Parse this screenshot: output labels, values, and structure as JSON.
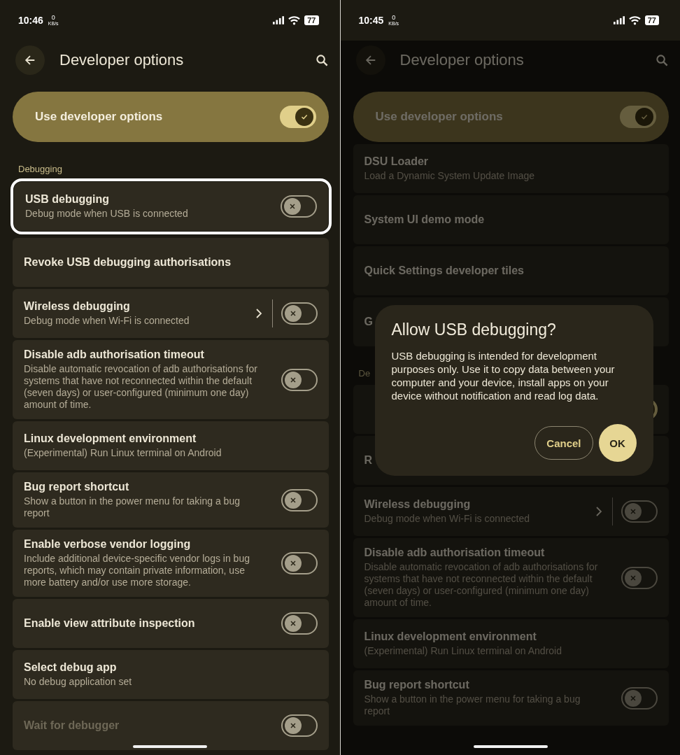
{
  "screens": [
    {
      "time": "10:46",
      "speed_value": "0",
      "speed_unit": "KB/s",
      "battery": "77",
      "title": "Developer options",
      "dimmed": false,
      "master": {
        "label": "Use developer options",
        "checked": true
      },
      "items": [
        {
          "kind": "section",
          "title": "Debugging"
        },
        {
          "kind": "toggle",
          "title": "USB debugging",
          "subtitle": "Debug mode when USB is connected",
          "checked": false,
          "highlighted": true,
          "disabled": false
        },
        {
          "kind": "link",
          "title": "Revoke USB debugging authorisations",
          "highlighted": false,
          "disabled": false
        },
        {
          "kind": "link_toggle",
          "title": "Wireless debugging",
          "subtitle": "Debug mode when Wi-Fi is connected",
          "checked": false,
          "highlighted": false,
          "disabled": false
        },
        {
          "kind": "toggle",
          "title": "Disable adb authorisation timeout",
          "subtitle": "Disable automatic revocation of adb authorisations for systems that have not reconnected within the default (seven days) or user-configured (minimum one day) amount of time.",
          "checked": false,
          "highlighted": false,
          "disabled": false
        },
        {
          "kind": "link",
          "title": "Linux development environment",
          "subtitle": "(Experimental) Run Linux terminal on Android",
          "highlighted": false,
          "disabled": false
        },
        {
          "kind": "toggle",
          "title": "Bug report shortcut",
          "subtitle": "Show a button in the power menu for taking a bug report",
          "checked": false,
          "highlighted": false,
          "disabled": false
        },
        {
          "kind": "toggle",
          "title": "Enable verbose vendor logging",
          "subtitle": "Include additional device-specific vendor logs in bug reports, which may contain private information, use more battery and/or use more storage.",
          "checked": false,
          "highlighted": false,
          "disabled": false
        },
        {
          "kind": "toggle",
          "title": "Enable view attribute inspection",
          "checked": false,
          "highlighted": false,
          "disabled": false
        },
        {
          "kind": "link",
          "title": "Select debug app",
          "subtitle": "No debug application set",
          "highlighted": false,
          "disabled": false
        },
        {
          "kind": "toggle",
          "title": "Wait for debugger",
          "checked": false,
          "highlighted": false,
          "disabled": true
        }
      ]
    },
    {
      "time": "10:45",
      "speed_value": "0",
      "speed_unit": "KB/s",
      "battery": "77",
      "title": "Developer options",
      "dimmed": true,
      "master": {
        "label": "Use developer options",
        "checked": true
      },
      "items": [
        {
          "kind": "link",
          "title": "DSU Loader",
          "subtitle": "Load a Dynamic System Update Image",
          "highlighted": false,
          "disabled": false
        },
        {
          "kind": "link",
          "title": "System UI demo mode",
          "highlighted": false,
          "disabled": false
        },
        {
          "kind": "link",
          "title": "Quick Settings developer tiles",
          "highlighted": false,
          "disabled": false
        },
        {
          "kind": "link",
          "title": "G",
          "highlighted": false,
          "disabled": false
        },
        {
          "kind": "section",
          "title": "De"
        },
        {
          "kind": "toggle",
          "checked": true,
          "highlighted": false,
          "disabled": false
        },
        {
          "kind": "link",
          "title": "R",
          "highlighted": false,
          "disabled": false
        },
        {
          "kind": "link_toggle",
          "title": "Wireless debugging",
          "subtitle": "Debug mode when Wi-Fi is connected",
          "checked": false,
          "highlighted": false,
          "disabled": false
        },
        {
          "kind": "toggle",
          "title": "Disable adb authorisation timeout",
          "subtitle": "Disable automatic revocation of adb authorisations for systems that have not reconnected within the default (seven days) or user-configured (minimum one day) amount of time.",
          "checked": false,
          "highlighted": false,
          "disabled": false
        },
        {
          "kind": "link",
          "title": "Linux development environment",
          "subtitle": "(Experimental) Run Linux terminal on Android",
          "highlighted": false,
          "disabled": false
        },
        {
          "kind": "toggle",
          "title": "Bug report shortcut",
          "subtitle": "Show a button in the power menu for taking a bug report",
          "checked": false,
          "highlighted": false,
          "disabled": false
        }
      ],
      "dialog": {
        "title": "Allow USB debugging?",
        "body": "USB debugging is intended for development purposes only. Use it to copy data between your computer and your device, install apps on your device without notification and read log data.",
        "buttons": [
          {
            "label": "Cancel",
            "kind": "outlined"
          },
          {
            "label": "OK",
            "kind": "filled"
          }
        ]
      }
    }
  ]
}
